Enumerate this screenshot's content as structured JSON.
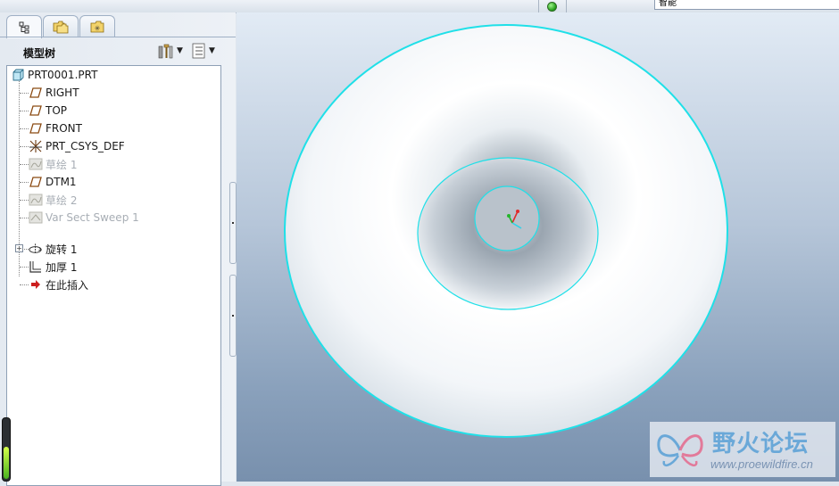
{
  "topbar": {
    "status_light_color": "#2fbf2a",
    "filter_value": "智能"
  },
  "panel": {
    "tabs": [
      {
        "name": "model-tree-tab",
        "icon": "model-tree-icon",
        "active": true
      },
      {
        "name": "folder-browser-tab",
        "icon": "folder-icon",
        "active": false
      },
      {
        "name": "favorites-tab",
        "icon": "favorites-icon",
        "active": false
      }
    ],
    "title": "模型树",
    "settings_icon": "tree-settings-icon",
    "show_icon": "tree-show-icon"
  },
  "tree": {
    "items": [
      {
        "label": "PRT0001.PRT",
        "icon": "part-icon",
        "dim": false
      },
      {
        "label": "RIGHT",
        "icon": "datum-plane-icon",
        "dim": false
      },
      {
        "label": "TOP",
        "icon": "datum-plane-icon",
        "dim": false
      },
      {
        "label": "FRONT",
        "icon": "datum-plane-icon",
        "dim": false
      },
      {
        "label": "PRT_CSYS_DEF",
        "icon": "csys-icon",
        "dim": false
      },
      {
        "label": "草绘 1",
        "icon": "sketch-icon",
        "dim": true
      },
      {
        "label": "DTM1",
        "icon": "datum-plane-icon",
        "dim": false
      },
      {
        "label": "草绘 2",
        "icon": "sketch-icon",
        "dim": true
      },
      {
        "label": "Var Sect Sweep 1",
        "icon": "sweep-icon",
        "dim": true
      },
      {
        "label": "旋转 1",
        "icon": "revolve-icon",
        "dim": false
      },
      {
        "label": "加厚 1",
        "icon": "thicken-icon",
        "dim": false
      },
      {
        "label": "在此插入",
        "icon": "insert-here-arrow-icon",
        "dim": false
      }
    ]
  },
  "colors": {
    "edge_highlight": "#1fe0e8",
    "insert_arrow": "#cc1f1f",
    "viewport_top": "#e2ebf5",
    "viewport_bottom": "#7890ad"
  },
  "progress": {
    "fraction": 0.55
  },
  "watermark": {
    "title": "野火论坛",
    "url": "www.proewildfire.cn",
    "logo_icon": "butterfly-logo-icon"
  }
}
